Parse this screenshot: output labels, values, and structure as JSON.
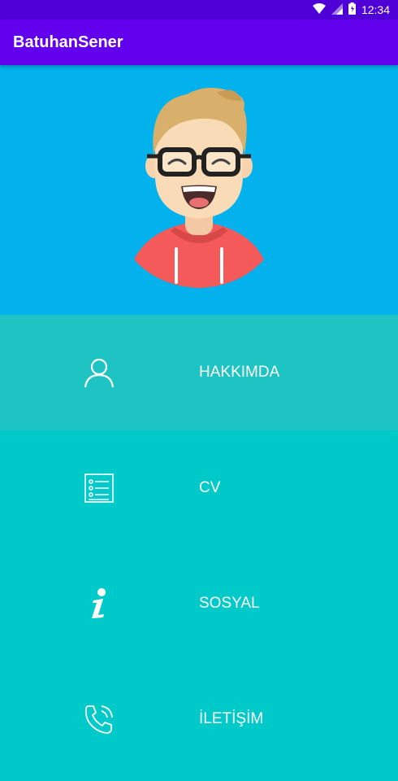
{
  "status_bar": {
    "time": "12:34"
  },
  "app_bar": {
    "title": "BatuhanSener"
  },
  "menu": {
    "items": [
      {
        "label": "HAKKIMDA",
        "icon": "person-icon"
      },
      {
        "label": "CV",
        "icon": "document-list-icon"
      },
      {
        "label": "SOSYAL",
        "icon": "info-icon"
      },
      {
        "label": "İLETİŞİM",
        "icon": "phone-icon"
      }
    ]
  },
  "colors": {
    "status_bar": "#4f00d6",
    "app_bar": "#6200ee",
    "hero": "#03b1ec",
    "menu_highlight": "#1ec3c3",
    "menu": "#00c9c9"
  }
}
